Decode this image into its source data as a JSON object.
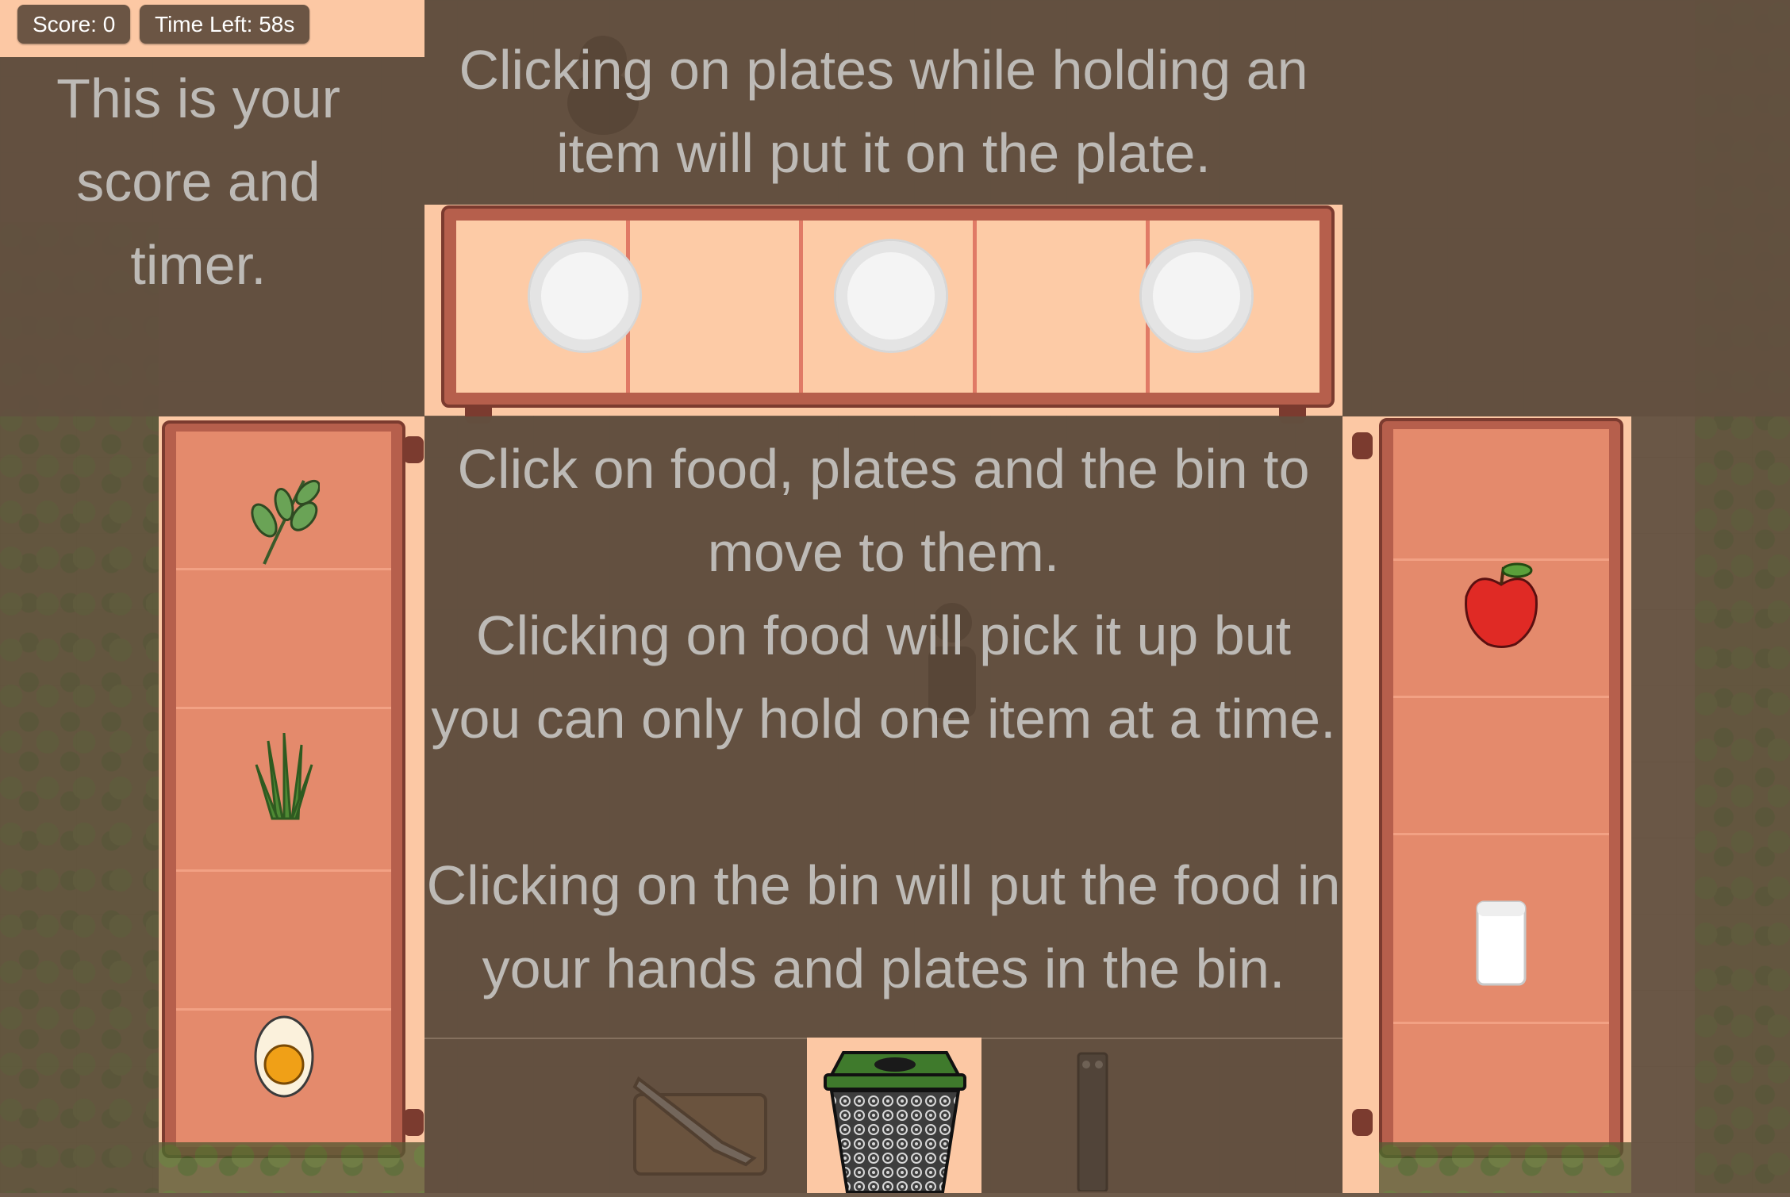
{
  "hud": {
    "score_label": "Score: 0",
    "time_label": "Time Left: 58s"
  },
  "tutorial": {
    "score_hint": "This is your score and timer.",
    "plates_hint": "Clicking on plates while holding an item will put it on the plate.",
    "main_hint_lines": [
      "Click on food, plates and the bin to move to them.",
      "Clicking on food will pick it up but you can only hold one item at a time.",
      "Clicking on the bin will put the food in your hands and plates in the bin."
    ]
  },
  "colors": {
    "hud_bg": "#fcc8a4",
    "counter_peach": "#fdcba6",
    "counter_salmon": "#e48a6c",
    "counter_frame": "#7b3b2f",
    "bin_green": "#3f7a2c",
    "overlay": "#62503f"
  },
  "food_items": [
    {
      "name": "herb-sprig-icon"
    },
    {
      "name": "grass-bunch-icon"
    },
    {
      "name": "boiled-egg-icon"
    },
    {
      "name": "apple-icon"
    },
    {
      "name": "milk-glass-icon"
    }
  ],
  "stations": [
    "cutting-board-icon",
    "trash-bin-icon",
    "stove-icon"
  ]
}
